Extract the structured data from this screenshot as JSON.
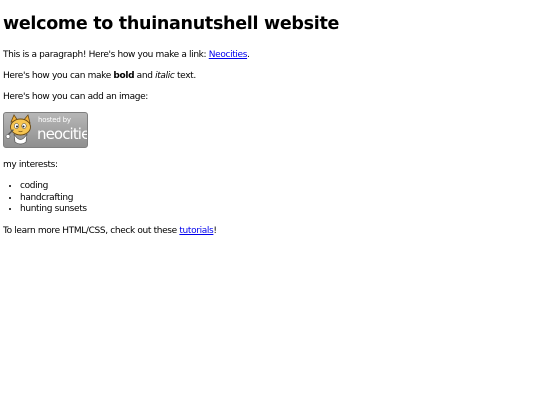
{
  "page": {
    "title": "welcome to thuinanutshell website"
  },
  "intro": {
    "before_link": "This is a paragraph! Here's how you make a link: ",
    "link_text": "Neocities",
    "after_link": "."
  },
  "formatting": {
    "before_bold": "Here's how you can make ",
    "bold_text": "bold",
    "between": " and ",
    "italic_text": "italic",
    "after_italic": " text."
  },
  "image_section": {
    "caption": "Here's how you can add an image:",
    "badge": {
      "icon": "neocities-cat-icon",
      "hosted_text": "hosted by",
      "brand_text": "neocities"
    }
  },
  "interests": {
    "heading": "my interests:",
    "items": [
      "coding",
      "handcrafting",
      "hunting sunsets"
    ]
  },
  "footer": {
    "before_link": "To learn more HTML/CSS, check out these ",
    "link_text": "tutorials",
    "after_link": "!"
  }
}
